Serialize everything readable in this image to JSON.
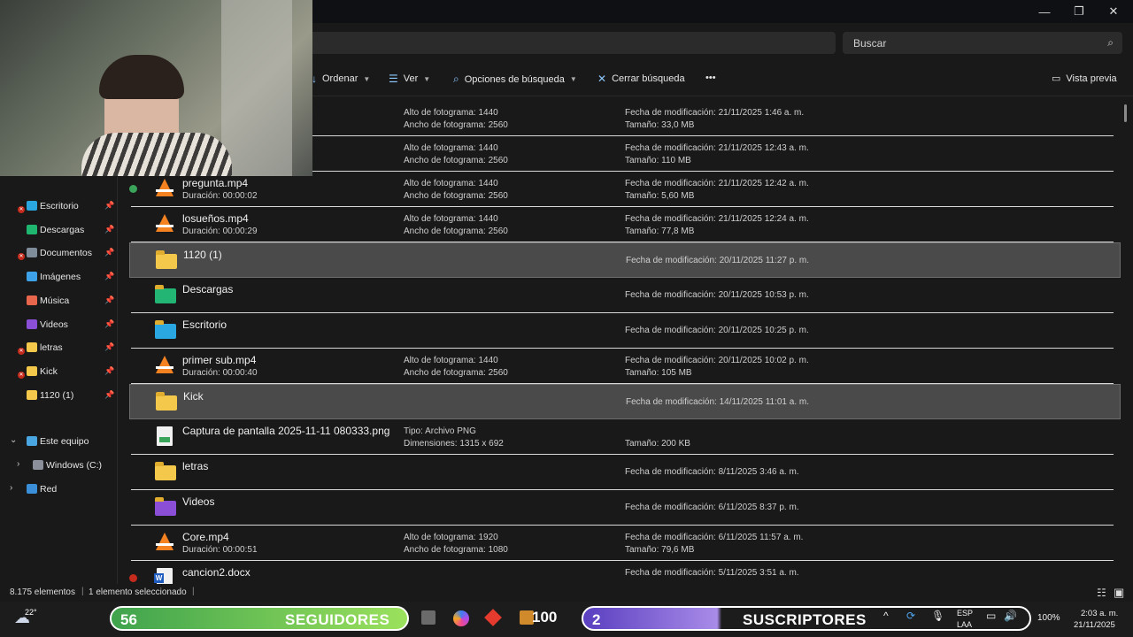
{
  "window": {
    "minimize": "—",
    "maximize": "❐",
    "close": "✕"
  },
  "search": {
    "placeholder": "Buscar"
  },
  "toolbar": {
    "ordenar": "Ordenar",
    "ver": "Ver",
    "opciones": "Opciones de búsqueda",
    "cerrar": "Cerrar búsqueda",
    "more": "•••",
    "preview": "Vista previa"
  },
  "sidebar": {
    "items": [
      {
        "label": "Escritorio",
        "color": "#2aa7e0",
        "error": true
      },
      {
        "label": "Descargas",
        "color": "#1fb66f",
        "error": false
      },
      {
        "label": "Documentos",
        "color": "#7f8c9a",
        "error": true
      },
      {
        "label": "Imágenes",
        "color": "#3ea2e8",
        "error": false
      },
      {
        "label": "Música",
        "color": "#e8664b",
        "error": false
      },
      {
        "label": "Videos",
        "color": "#8a4fd6",
        "error": false
      },
      {
        "label": "letras",
        "color": "#f3c84b",
        "error": true
      },
      {
        "label": "Kick",
        "color": "#f3c84b",
        "error": true
      },
      {
        "label": "1120 (1)",
        "color": "#f3c84b",
        "error": false
      }
    ],
    "pin": "📌",
    "este_equipo": "Este equipo",
    "windows": "Windows (C:)",
    "red": "Red"
  },
  "files": [
    {
      "type": "none",
      "name": "",
      "sub": "",
      "c2a": "Alto de fotograma: 1440",
      "c2b": "Ancho de fotograma: 2560",
      "c3a": "Fecha de modificación: 21/11/2025 1:46 a. m.",
      "c3b": "Tamaño: 33,0 MB"
    },
    {
      "type": "none",
      "name": "",
      "sub": "",
      "c2a": "Alto de fotograma: 1440",
      "c2b": "Ancho de fotograma: 2560",
      "c3a": "Fecha de modificación: 21/11/2025 12:43 a. m.",
      "c3b": "Tamaño: 110 MB"
    },
    {
      "type": "vlc",
      "name": "pregunta.mp4",
      "sub": "Duración: 00:00:02",
      "c2a": "Alto de fotograma: 1440",
      "c2b": "Ancho de fotograma: 2560",
      "c3a": "Fecha de modificación: 21/11/2025 12:42 a. m.",
      "c3b": "Tamaño: 5,60 MB"
    },
    {
      "type": "vlc",
      "name": "losueños.mp4",
      "sub": "Duración: 00:00:29",
      "c2a": "Alto de fotograma: 1440",
      "c2b": "Ancho de fotograma: 2560",
      "c3a": "Fecha de modificación: 21/11/2025 12:24 a. m.",
      "c3b": "Tamaño: 77,8 MB"
    },
    {
      "type": "folder",
      "name": "1120 (1)",
      "sub": "",
      "c2a": "",
      "c2b": "",
      "c3a": "",
      "c3b": "Fecha de modificación: 20/11/2025 11:27 p. m.",
      "sel": true
    },
    {
      "type": "folder-green",
      "name": "Descargas",
      "sub": "",
      "c2a": "",
      "c2b": "",
      "c3a": "",
      "c3b": "Fecha de modificación: 20/11/2025 10:53 p. m."
    },
    {
      "type": "folder-blue",
      "name": "Escritorio",
      "sub": "",
      "c2a": "",
      "c2b": "",
      "c3a": "",
      "c3b": "Fecha de modificación: 20/11/2025 10:25 p. m."
    },
    {
      "type": "vlc",
      "name": "primer sub.mp4",
      "sub": "Duración: 00:00:40",
      "c2a": "Alto de fotograma: 1440",
      "c2b": "Ancho de fotograma: 2560",
      "c3a": "Fecha de modificación: 20/11/2025 10:02 p. m.",
      "c3b": "Tamaño: 105 MB"
    },
    {
      "type": "folder",
      "name": "Kick",
      "sub": "",
      "c2a": "",
      "c2b": "",
      "c3a": "",
      "c3b": "Fecha de modificación: 14/11/2025 11:01 a. m.",
      "sel": true
    },
    {
      "type": "png",
      "name": "Captura de pantalla 2025-11-11 080333.png",
      "sub": "",
      "c2a": "Tipo: Archivo PNG",
      "c2b": "Dimensiones: 1315 x 692",
      "c3a": "",
      "c3b": "Tamaño: 200 KB"
    },
    {
      "type": "folder",
      "name": "letras",
      "sub": "",
      "c2a": "",
      "c2b": "",
      "c3a": "",
      "c3b": "Fecha de modificación: 8/11/2025 3:46 a. m."
    },
    {
      "type": "folder-purple",
      "name": "Videos",
      "sub": "",
      "c2a": "",
      "c2b": "",
      "c3a": "",
      "c3b": "Fecha de modificación: 6/11/2025 8:37 p. m."
    },
    {
      "type": "vlc",
      "name": "Core.mp4",
      "sub": "Duración: 00:00:51",
      "c2a": "Alto de fotograma: 1920",
      "c2b": "Ancho de fotograma: 1080",
      "c3a": "Fecha de modificación: 6/11/2025 11:57 a. m.",
      "c3b": "Tamaño: 79,6 MB"
    },
    {
      "type": "word",
      "name": "cancion2.docx",
      "sub": "",
      "c2a": "",
      "c2b": "",
      "c3a": "Fecha de modificación: 5/11/2025 3:51 a. m.",
      "c3b": ""
    }
  ],
  "status": {
    "count": "8.175 elementos",
    "selected": "1 elemento seleccionado"
  },
  "taskbar": {
    "temp": "22°",
    "seguidores_num": "56",
    "seguidores": "SEGUIDORES",
    "badge": "100",
    "suscriptores_num": "2",
    "suscriptores": "SUSCRIPTORES",
    "lang1": "ESP",
    "lang2": "LAA",
    "battery": "100%",
    "time": "2:03 a. m.",
    "date": "21/11/2025"
  }
}
